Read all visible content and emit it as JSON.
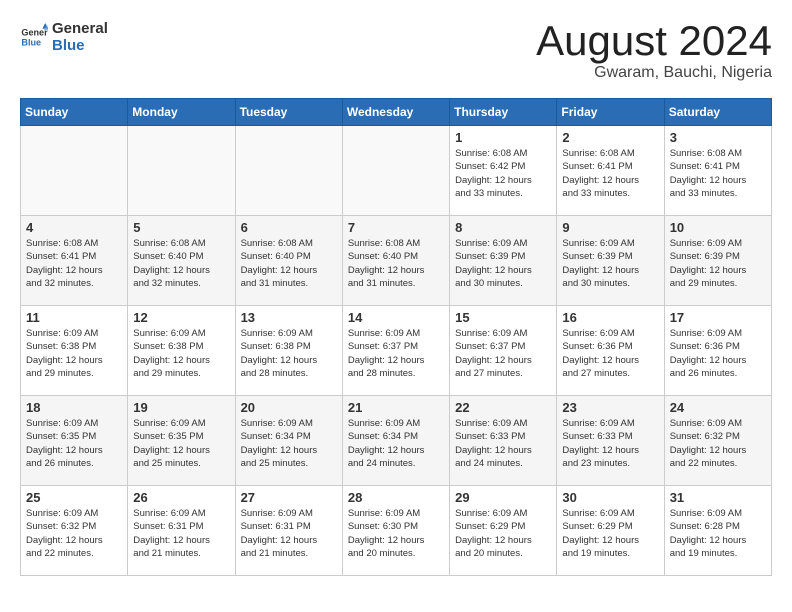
{
  "header": {
    "logo_line1": "General",
    "logo_line2": "Blue",
    "title": "August 2024",
    "subtitle": "Gwaram, Bauchi, Nigeria"
  },
  "weekdays": [
    "Sunday",
    "Monday",
    "Tuesday",
    "Wednesday",
    "Thursday",
    "Friday",
    "Saturday"
  ],
  "weeks": [
    [
      {
        "day": "",
        "info": ""
      },
      {
        "day": "",
        "info": ""
      },
      {
        "day": "",
        "info": ""
      },
      {
        "day": "",
        "info": ""
      },
      {
        "day": "1",
        "info": "Sunrise: 6:08 AM\nSunset: 6:42 PM\nDaylight: 12 hours\nand 33 minutes."
      },
      {
        "day": "2",
        "info": "Sunrise: 6:08 AM\nSunset: 6:41 PM\nDaylight: 12 hours\nand 33 minutes."
      },
      {
        "day": "3",
        "info": "Sunrise: 6:08 AM\nSunset: 6:41 PM\nDaylight: 12 hours\nand 33 minutes."
      }
    ],
    [
      {
        "day": "4",
        "info": "Sunrise: 6:08 AM\nSunset: 6:41 PM\nDaylight: 12 hours\nand 32 minutes."
      },
      {
        "day": "5",
        "info": "Sunrise: 6:08 AM\nSunset: 6:40 PM\nDaylight: 12 hours\nand 32 minutes."
      },
      {
        "day": "6",
        "info": "Sunrise: 6:08 AM\nSunset: 6:40 PM\nDaylight: 12 hours\nand 31 minutes."
      },
      {
        "day": "7",
        "info": "Sunrise: 6:08 AM\nSunset: 6:40 PM\nDaylight: 12 hours\nand 31 minutes."
      },
      {
        "day": "8",
        "info": "Sunrise: 6:09 AM\nSunset: 6:39 PM\nDaylight: 12 hours\nand 30 minutes."
      },
      {
        "day": "9",
        "info": "Sunrise: 6:09 AM\nSunset: 6:39 PM\nDaylight: 12 hours\nand 30 minutes."
      },
      {
        "day": "10",
        "info": "Sunrise: 6:09 AM\nSunset: 6:39 PM\nDaylight: 12 hours\nand 29 minutes."
      }
    ],
    [
      {
        "day": "11",
        "info": "Sunrise: 6:09 AM\nSunset: 6:38 PM\nDaylight: 12 hours\nand 29 minutes."
      },
      {
        "day": "12",
        "info": "Sunrise: 6:09 AM\nSunset: 6:38 PM\nDaylight: 12 hours\nand 29 minutes."
      },
      {
        "day": "13",
        "info": "Sunrise: 6:09 AM\nSunset: 6:38 PM\nDaylight: 12 hours\nand 28 minutes."
      },
      {
        "day": "14",
        "info": "Sunrise: 6:09 AM\nSunset: 6:37 PM\nDaylight: 12 hours\nand 28 minutes."
      },
      {
        "day": "15",
        "info": "Sunrise: 6:09 AM\nSunset: 6:37 PM\nDaylight: 12 hours\nand 27 minutes."
      },
      {
        "day": "16",
        "info": "Sunrise: 6:09 AM\nSunset: 6:36 PM\nDaylight: 12 hours\nand 27 minutes."
      },
      {
        "day": "17",
        "info": "Sunrise: 6:09 AM\nSunset: 6:36 PM\nDaylight: 12 hours\nand 26 minutes."
      }
    ],
    [
      {
        "day": "18",
        "info": "Sunrise: 6:09 AM\nSunset: 6:35 PM\nDaylight: 12 hours\nand 26 minutes."
      },
      {
        "day": "19",
        "info": "Sunrise: 6:09 AM\nSunset: 6:35 PM\nDaylight: 12 hours\nand 25 minutes."
      },
      {
        "day": "20",
        "info": "Sunrise: 6:09 AM\nSunset: 6:34 PM\nDaylight: 12 hours\nand 25 minutes."
      },
      {
        "day": "21",
        "info": "Sunrise: 6:09 AM\nSunset: 6:34 PM\nDaylight: 12 hours\nand 24 minutes."
      },
      {
        "day": "22",
        "info": "Sunrise: 6:09 AM\nSunset: 6:33 PM\nDaylight: 12 hours\nand 24 minutes."
      },
      {
        "day": "23",
        "info": "Sunrise: 6:09 AM\nSunset: 6:33 PM\nDaylight: 12 hours\nand 23 minutes."
      },
      {
        "day": "24",
        "info": "Sunrise: 6:09 AM\nSunset: 6:32 PM\nDaylight: 12 hours\nand 22 minutes."
      }
    ],
    [
      {
        "day": "25",
        "info": "Sunrise: 6:09 AM\nSunset: 6:32 PM\nDaylight: 12 hours\nand 22 minutes."
      },
      {
        "day": "26",
        "info": "Sunrise: 6:09 AM\nSunset: 6:31 PM\nDaylight: 12 hours\nand 21 minutes."
      },
      {
        "day": "27",
        "info": "Sunrise: 6:09 AM\nSunset: 6:31 PM\nDaylight: 12 hours\nand 21 minutes."
      },
      {
        "day": "28",
        "info": "Sunrise: 6:09 AM\nSunset: 6:30 PM\nDaylight: 12 hours\nand 20 minutes."
      },
      {
        "day": "29",
        "info": "Sunrise: 6:09 AM\nSunset: 6:29 PM\nDaylight: 12 hours\nand 20 minutes."
      },
      {
        "day": "30",
        "info": "Sunrise: 6:09 AM\nSunset: 6:29 PM\nDaylight: 12 hours\nand 19 minutes."
      },
      {
        "day": "31",
        "info": "Sunrise: 6:09 AM\nSunset: 6:28 PM\nDaylight: 12 hours\nand 19 minutes."
      }
    ]
  ]
}
